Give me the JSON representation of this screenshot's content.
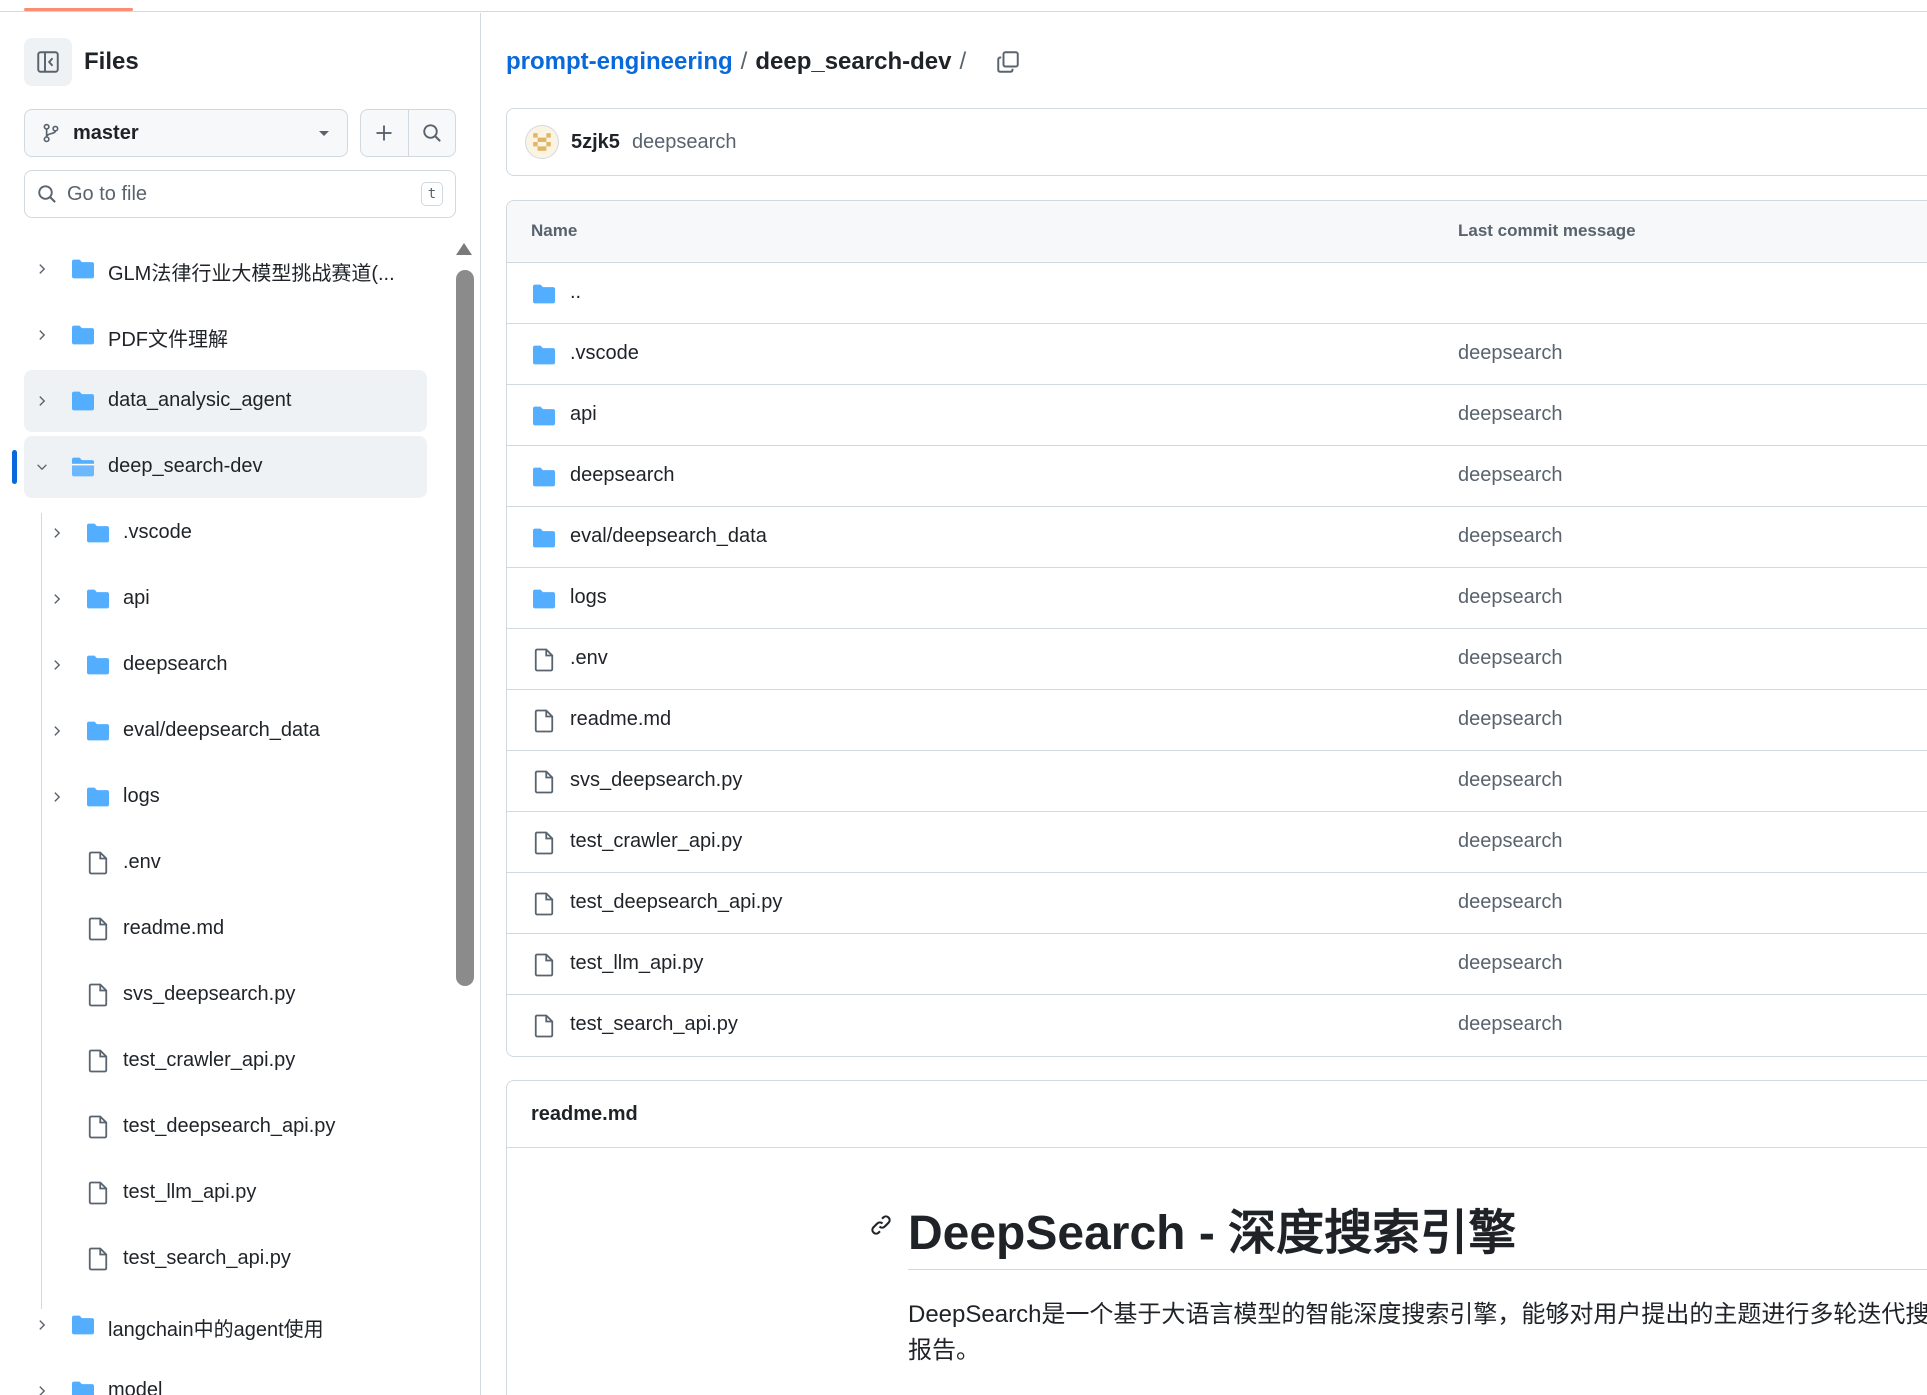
{
  "sidebar": {
    "title": "Files",
    "branch": "master",
    "goto_placeholder": "Go to file",
    "goto_shortcut": "t",
    "tree": [
      {
        "label": "GLM法律行业大模型挑战赛道(...",
        "type": "folder",
        "depth": 0,
        "expanded": false
      },
      {
        "label": "PDF文件理解",
        "type": "folder",
        "depth": 0,
        "expanded": false
      },
      {
        "label": "data_analysic_agent",
        "type": "folder",
        "depth": 0,
        "expanded": false,
        "hover": true
      },
      {
        "label": "deep_search-dev",
        "type": "folder-open",
        "depth": 0,
        "expanded": true,
        "current": true
      },
      {
        "label": ".vscode",
        "type": "folder",
        "depth": 1,
        "expanded": false
      },
      {
        "label": "api",
        "type": "folder",
        "depth": 1,
        "expanded": false
      },
      {
        "label": "deepsearch",
        "type": "folder",
        "depth": 1,
        "expanded": false
      },
      {
        "label": "eval/deepsearch_data",
        "type": "folder",
        "depth": 1,
        "expanded": false
      },
      {
        "label": "logs",
        "type": "folder",
        "depth": 1,
        "expanded": false
      },
      {
        "label": ".env",
        "type": "file",
        "depth": 1
      },
      {
        "label": "readme.md",
        "type": "file",
        "depth": 1
      },
      {
        "label": "svs_deepsearch.py",
        "type": "file",
        "depth": 1
      },
      {
        "label": "test_crawler_api.py",
        "type": "file",
        "depth": 1
      },
      {
        "label": "test_deepsearch_api.py",
        "type": "file",
        "depth": 1
      },
      {
        "label": "test_llm_api.py",
        "type": "file",
        "depth": 1
      },
      {
        "label": "test_search_api.py",
        "type": "file",
        "depth": 1
      },
      {
        "label": "langchain中的agent使用",
        "type": "folder",
        "depth": 0,
        "expanded": false
      },
      {
        "label": "model",
        "type": "folder",
        "depth": 0,
        "expanded": false
      }
    ]
  },
  "breadcrumb": {
    "repo": "prompt-engineering",
    "separator": "/",
    "current": "deep_search-dev"
  },
  "commit": {
    "user": "5zjk5",
    "message": "deepsearch"
  },
  "table": {
    "col_name": "Name",
    "col_msg": "Last commit message",
    "rows": [
      {
        "name": "..",
        "type": "folder",
        "msg": ""
      },
      {
        "name": ".vscode",
        "type": "folder",
        "msg": "deepsearch"
      },
      {
        "name": "api",
        "type": "folder",
        "msg": "deepsearch"
      },
      {
        "name": "deepsearch",
        "type": "folder",
        "msg": "deepsearch"
      },
      {
        "name": "eval/deepsearch_data",
        "type": "folder",
        "msg": "deepsearch"
      },
      {
        "name": "logs",
        "type": "folder",
        "msg": "deepsearch"
      },
      {
        "name": ".env",
        "type": "file",
        "msg": "deepsearch"
      },
      {
        "name": "readme.md",
        "type": "file",
        "msg": "deepsearch"
      },
      {
        "name": "svs_deepsearch.py",
        "type": "file",
        "msg": "deepsearch"
      },
      {
        "name": "test_crawler_api.py",
        "type": "file",
        "msg": "deepsearch"
      },
      {
        "name": "test_deepsearch_api.py",
        "type": "file",
        "msg": "deepsearch"
      },
      {
        "name": "test_llm_api.py",
        "type": "file",
        "msg": "deepsearch"
      },
      {
        "name": "test_search_api.py",
        "type": "file",
        "msg": "deepsearch"
      }
    ]
  },
  "readme": {
    "filename": "readme.md",
    "title": "DeepSearch - 深度搜索引擎",
    "para_line1": "DeepSearch是一个基于大语言模型的智能深度搜索引擎，能够对用户提出的主题进行多轮迭代搜索",
    "para_line2": "报告。"
  },
  "colors": {
    "accent": "#0969da",
    "folder": "#54aeff",
    "muted": "#59636e",
    "border": "#d1d9e0"
  }
}
